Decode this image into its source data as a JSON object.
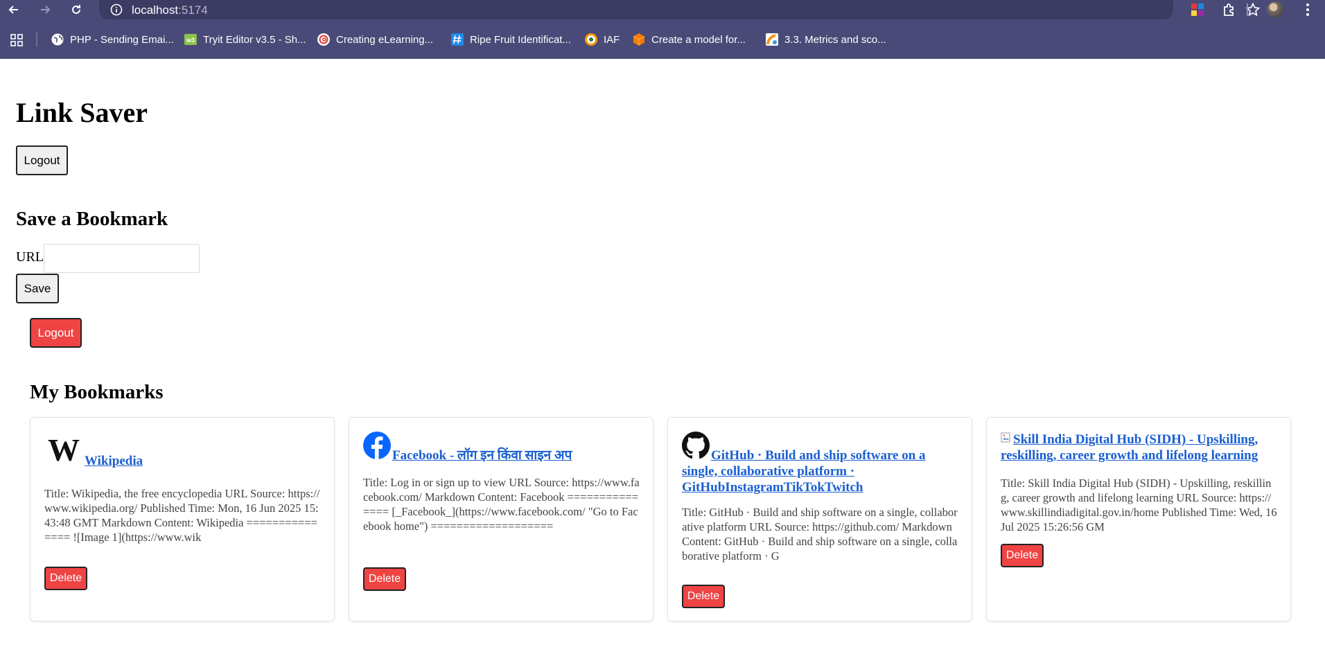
{
  "browser": {
    "url_host": "localhost",
    "url_port": ":5174",
    "bookmarks": [
      {
        "label": "PHP - Sending Emai...",
        "icon": "globe-icon",
        "color": "#ffffff"
      },
      {
        "label": "Tryit Editor v3.5 - Sh...",
        "icon": "w3schools-icon",
        "color": "#8bc34a"
      },
      {
        "label": "Creating eLearning...",
        "icon": "spiral-icon",
        "color": "#e53935"
      },
      {
        "label": "Ripe Fruit Identificat...",
        "icon": "hash-icon",
        "color": "#1e88e5"
      },
      {
        "label": "IAF",
        "icon": "roundel-icon",
        "color": "#ff9800"
      },
      {
        "label": "Create a model for...",
        "icon": "cube-icon",
        "color": "#f57c00"
      },
      {
        "label": "3.3. Metrics and sco...",
        "icon": "sklearn-icon",
        "color": "#f7931e"
      }
    ]
  },
  "app": {
    "title": "Link Saver",
    "logout_label": "Logout",
    "save_section_title": "Save a Bookmark",
    "url_label": "URL",
    "url_value": "",
    "save_label": "Save",
    "logout_red_label": "Logout",
    "bookmarks_title": "My Bookmarks",
    "accent_red": "#ef4444",
    "link_color": "#1a5fd0"
  },
  "bookmarks": [
    {
      "icon": "wikipedia-icon",
      "title": "Wikipedia",
      "content": "Title: Wikipedia, the free encyclopedia URL Source: https://www.wikipedia.org/ Published Time: Mon, 16 Jun 2025 15:43:48 GMT Markdown Content: Wikipedia =============== ![Image 1](https://www.wik",
      "delete_label": "Delete"
    },
    {
      "icon": "facebook-icon",
      "title": "Facebook - लॉग इन किंवा साइन अप",
      "content": "Title: Log in or sign up to view URL Source: https://www.facebook.com/ Markdown Content: Facebook =============== [_Facebook_](https://www.facebook.com/ \"Go to Facebook home\") ===================",
      "delete_label": "Delete"
    },
    {
      "icon": "github-icon",
      "title": "GitHub · Build and ship software on a single, collaborative platform · GitHubInstagramTikTokTwitch",
      "content": "Title: GitHub · Build and ship software on a single, collaborative platform URL Source: https://github.com/ Markdown Content: GitHub · Build and ship software on a single, collaborative platform · G",
      "delete_label": "Delete"
    },
    {
      "icon": "broken-image-icon",
      "title": "Skill India Digital Hub (SIDH) - Upskilling, reskilling, career growth and lifelong learning",
      "content": "Title: Skill India Digital Hub (SIDH) - Upskilling, reskilling, career growth and lifelong learning URL Source: https://www.skillindiadigital.gov.in/home Published Time: Wed, 16 Jul 2025 15:26:56 GM",
      "delete_label": "Delete"
    }
  ]
}
